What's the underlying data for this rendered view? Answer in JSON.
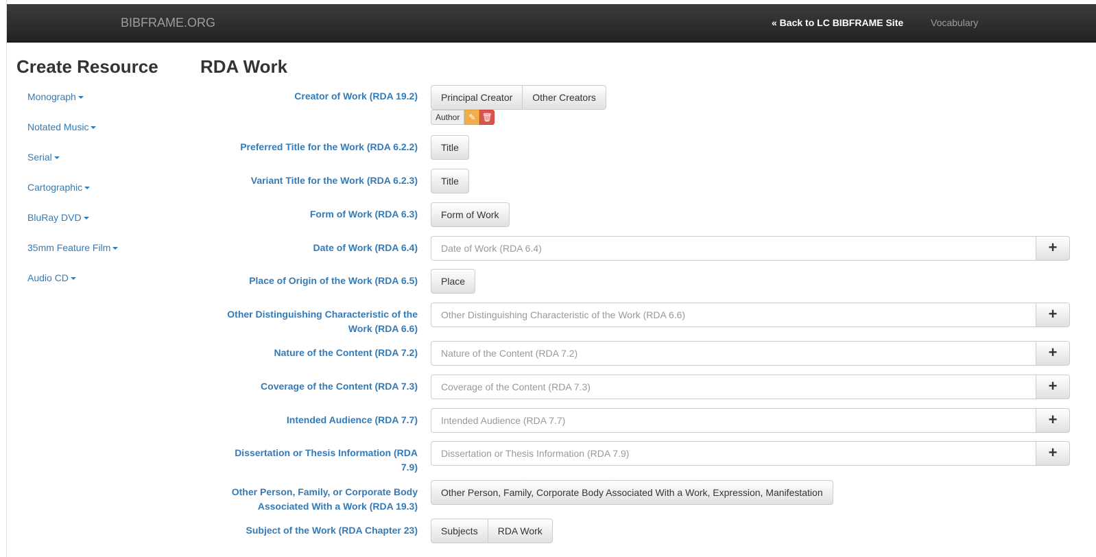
{
  "navbar": {
    "brand": "BIBFRAME.ORG",
    "back_link": "« Back to LC BIBFRAME Site",
    "vocabulary": "Vocabulary"
  },
  "sidebar": {
    "title": "Create Resource",
    "items": [
      {
        "label": "Monograph"
      },
      {
        "label": "Notated Music"
      },
      {
        "label": "Serial"
      },
      {
        "label": "Cartographic"
      },
      {
        "label": "BluRay DVD"
      },
      {
        "label": "35mm Feature Film"
      },
      {
        "label": "Audio CD"
      }
    ]
  },
  "form": {
    "title": "RDA Work",
    "creator": {
      "label": "Creator of Work (RDA 19.2)",
      "buttons": [
        "Principal Creator",
        "Other Creators"
      ],
      "tag": "Author"
    },
    "preferred_title": {
      "label": "Preferred Title for the Work (RDA 6.2.2)",
      "button": "Title"
    },
    "variant_title": {
      "label": "Variant Title for the Work (RDA 6.2.3)",
      "button": "Title"
    },
    "form_of_work": {
      "label": "Form of Work (RDA 6.3)",
      "button": "Form of Work"
    },
    "date_of_work": {
      "label": "Date of Work (RDA 6.4)",
      "placeholder": "Date of Work (RDA 6.4)",
      "plus": "+"
    },
    "place_of_origin": {
      "label": "Place of Origin of the Work (RDA 6.5)",
      "button": "Place"
    },
    "other_distinguishing": {
      "label_line1": "Other Distinguishing Characteristic of the",
      "label_line2": "Work (RDA 6.6)",
      "placeholder": "Other Distinguishing Characteristic of the Work (RDA 6.6)",
      "plus": "+"
    },
    "nature_of_content": {
      "label": "Nature of the Content (RDA 7.2)",
      "placeholder": "Nature of the Content (RDA 7.2)",
      "plus": "+"
    },
    "coverage_of_content": {
      "label": "Coverage of the Content (RDA 7.3)",
      "placeholder": "Coverage of the Content (RDA 7.3)",
      "plus": "+"
    },
    "intended_audience": {
      "label": "Intended Audience (RDA 7.7)",
      "placeholder": "Intended Audience (RDA 7.7)",
      "plus": "+"
    },
    "dissertation": {
      "label_line1": "Dissertation or Thesis Information (RDA",
      "label_line2": "7.9)",
      "placeholder": "Dissertation or Thesis Information (RDA 7.9)",
      "plus": "+"
    },
    "other_person": {
      "label_line1": "Other Person, Family, or Corporate Body",
      "label_line2": "Associated With a Work (RDA 19.3)",
      "button": "Other Person, Family, Corporate Body Associated With a Work, Expression, Manifestation"
    },
    "subject": {
      "label": "Subject of the Work (RDA Chapter 23)",
      "buttons": [
        "Subjects",
        "RDA Work"
      ]
    }
  }
}
